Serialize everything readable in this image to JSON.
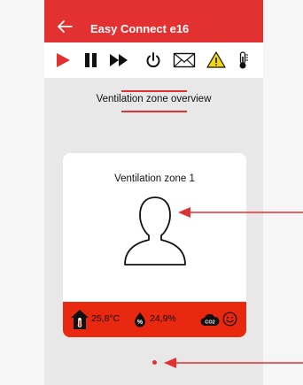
{
  "header": {
    "title": "Easy Connect e16",
    "back_icon": "arrow-left-icon"
  },
  "toolbar": {
    "items": [
      {
        "name": "play",
        "icon": "play-icon"
      },
      {
        "name": "pause",
        "icon": "pause-icon"
      },
      {
        "name": "fast-forward",
        "icon": "fast-forward-icon"
      },
      {
        "name": "power",
        "icon": "power-icon"
      },
      {
        "name": "messages",
        "icon": "envelope-icon"
      },
      {
        "name": "warning",
        "icon": "warning-icon"
      },
      {
        "name": "temperature",
        "icon": "thermometer-icon"
      }
    ]
  },
  "section": {
    "title": "Ventilation zone overview"
  },
  "zone": {
    "name": "Ventilation zone 1",
    "temperature": "25,8°C",
    "humidity": "24,9%",
    "co2_label": "CO2",
    "humidity_symbol": "%",
    "mood_icon": "smiley-icon"
  },
  "colors": {
    "accent": "#e33131",
    "stats_bar": "#e8280f",
    "warning": "#f2c200"
  }
}
